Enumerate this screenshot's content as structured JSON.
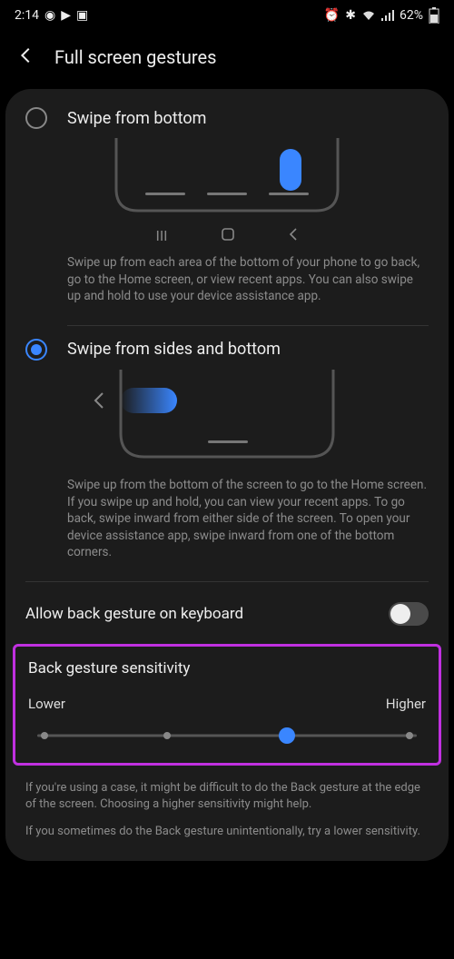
{
  "status": {
    "time": "2:14",
    "battery": "62%"
  },
  "header": {
    "title": "Full screen gestures"
  },
  "option1": {
    "title": "Swipe from bottom",
    "desc": "Swipe up from each area of the bottom of your phone to go back, go to the Home screen, or view recent apps. You can also swipe up and hold to use your device assistance app."
  },
  "option2": {
    "title": "Swipe from sides and bottom",
    "desc": "Swipe up from the bottom of the screen to go to the Home screen. If you swipe up and hold, you can view your recent apps. To go back, swipe inward from either side of the screen. To open your device assistance app, swipe inward from one of the bottom corners."
  },
  "toggle_row": {
    "label": "Allow back gesture on keyboard"
  },
  "sensitivity": {
    "title": "Back gesture sensitivity",
    "lower": "Lower",
    "higher": "Higher"
  },
  "footnote": {
    "p1": "If you're using a case, it might be difficult to do the Back gesture at the edge of the screen. Choosing a higher sensitivity might help.",
    "p2": "If you sometimes do the Back gesture unintentionally, try a lower sensitivity."
  }
}
